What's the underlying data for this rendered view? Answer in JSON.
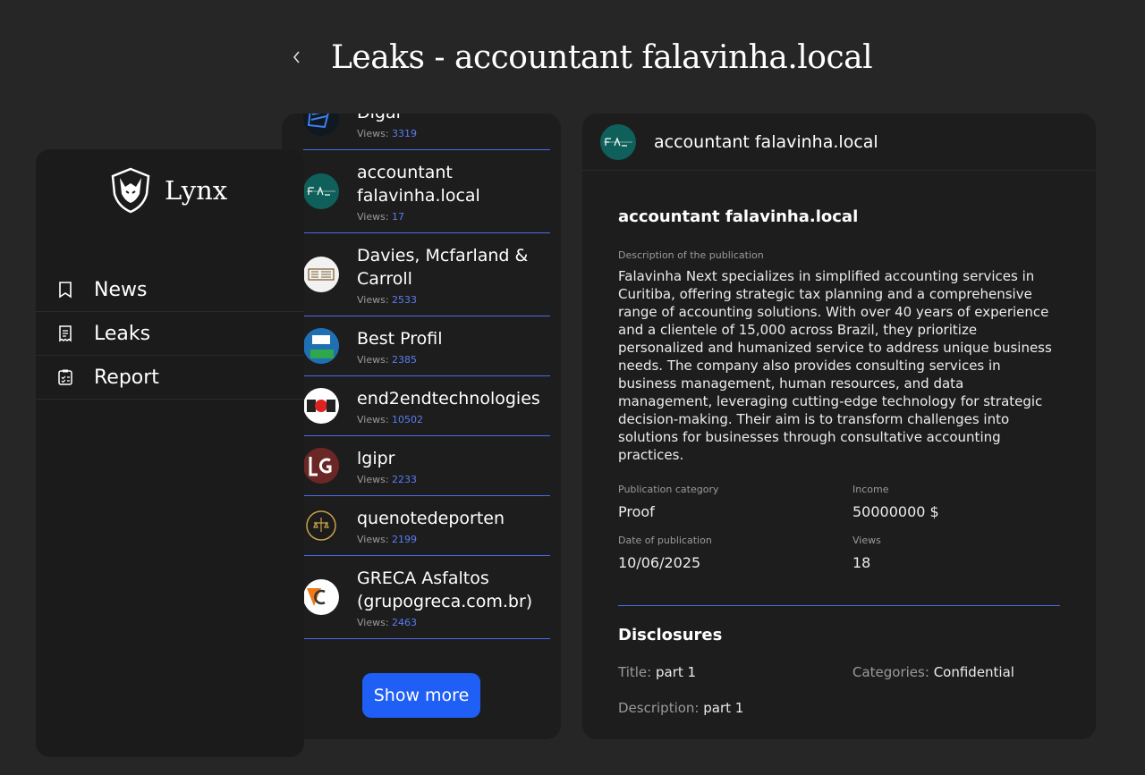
{
  "page": {
    "title": "Leaks - accountant falavinha.local"
  },
  "brand": {
    "name": "Lynx"
  },
  "nav": [
    {
      "label": "News",
      "icon": "bookmark-icon"
    },
    {
      "label": "Leaks",
      "icon": "receipt-icon"
    },
    {
      "label": "Report",
      "icon": "checklist-icon"
    }
  ],
  "list": {
    "views_label": "Views:",
    "items": [
      {
        "name": "Digar",
        "views": "3319"
      },
      {
        "name": "accountant falavinha.local",
        "views": "17"
      },
      {
        "name": "Davies, Mcfarland & Carroll",
        "views": "2533"
      },
      {
        "name": "Best Profil",
        "views": "2385"
      },
      {
        "name": "end2endtechnologies",
        "views": "10502"
      },
      {
        "name": "lgipr",
        "views": "2233"
      },
      {
        "name": "quenotedeporten",
        "views": "2199"
      },
      {
        "name": "GRECA Asfaltos (grupogreca.com.br)",
        "views": "2463"
      }
    ],
    "show_more_label": "Show more"
  },
  "detail": {
    "header_title": "accountant falavinha.local",
    "title": "accountant falavinha.local",
    "description_label": "Description of the publication",
    "description": "Falavinha Next specializes in simplified accounting services in Curitiba, offering strategic tax planning and a comprehensive range of accounting solutions. With over 40 years of experience and a clientele of 15,000 across Brazil, they prioritize personalized and humanized service to address unique business needs. The company also provides consulting services in business management, human resources, and data management, leveraging cutting-edge technology for strategic decision-making. Their aim is to transform challenges into solutions for businesses through consultative accounting practices.",
    "category_label": "Publication category",
    "category": "Proof",
    "income_label": "Income",
    "income": "50000000 $",
    "date_label": "Date of publication",
    "date": "10/06/2025",
    "views_label": "Views",
    "views": "18",
    "disclosures_title": "Disclosures",
    "disclosure": {
      "title_key": "Title:",
      "title_value": "part 1",
      "categories_key": "Categories:",
      "categories_value": "Confidential",
      "description_key": "Description:",
      "description_value": "part 1"
    }
  },
  "colors": {
    "background": "#262626",
    "panel": "#1d1d1d",
    "sidebar": "#1b1b1b",
    "accent": "#1f5ff5",
    "divider": "#4e6ae8",
    "views_number": "#5b7cf0"
  }
}
